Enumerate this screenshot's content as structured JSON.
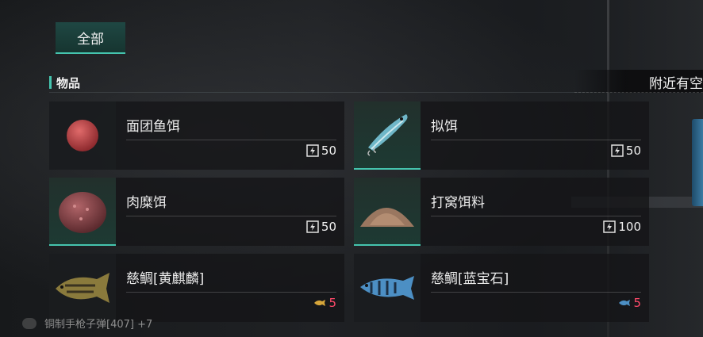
{
  "tabs": {
    "all": "全部"
  },
  "section": {
    "title": "物品"
  },
  "nearby": {
    "label": "附近有空"
  },
  "items": [
    {
      "name": "面团鱼饵",
      "quantity": "50",
      "icon": "bait-icon",
      "selected": false
    },
    {
      "name": "拟饵",
      "quantity": "50",
      "icon": "bait-icon",
      "selected": true
    },
    {
      "name": "肉糜饵",
      "quantity": "50",
      "icon": "bait-icon",
      "selected": true
    },
    {
      "name": "打窝饵料",
      "quantity": "100",
      "icon": "bait-icon",
      "selected": true
    },
    {
      "name": "慈鲷[黄麒麟]",
      "quantity": "5",
      "icon": "fish-icon",
      "selected": false
    },
    {
      "name": "慈鲷[蓝宝石]",
      "quantity": "5",
      "icon": "fish-icon",
      "selected": false
    }
  ],
  "ticker": {
    "text": "铜制手枪子弹[407] +7"
  },
  "colors": {
    "accent": "#45c4ae",
    "rare": "#ff4a6a"
  }
}
